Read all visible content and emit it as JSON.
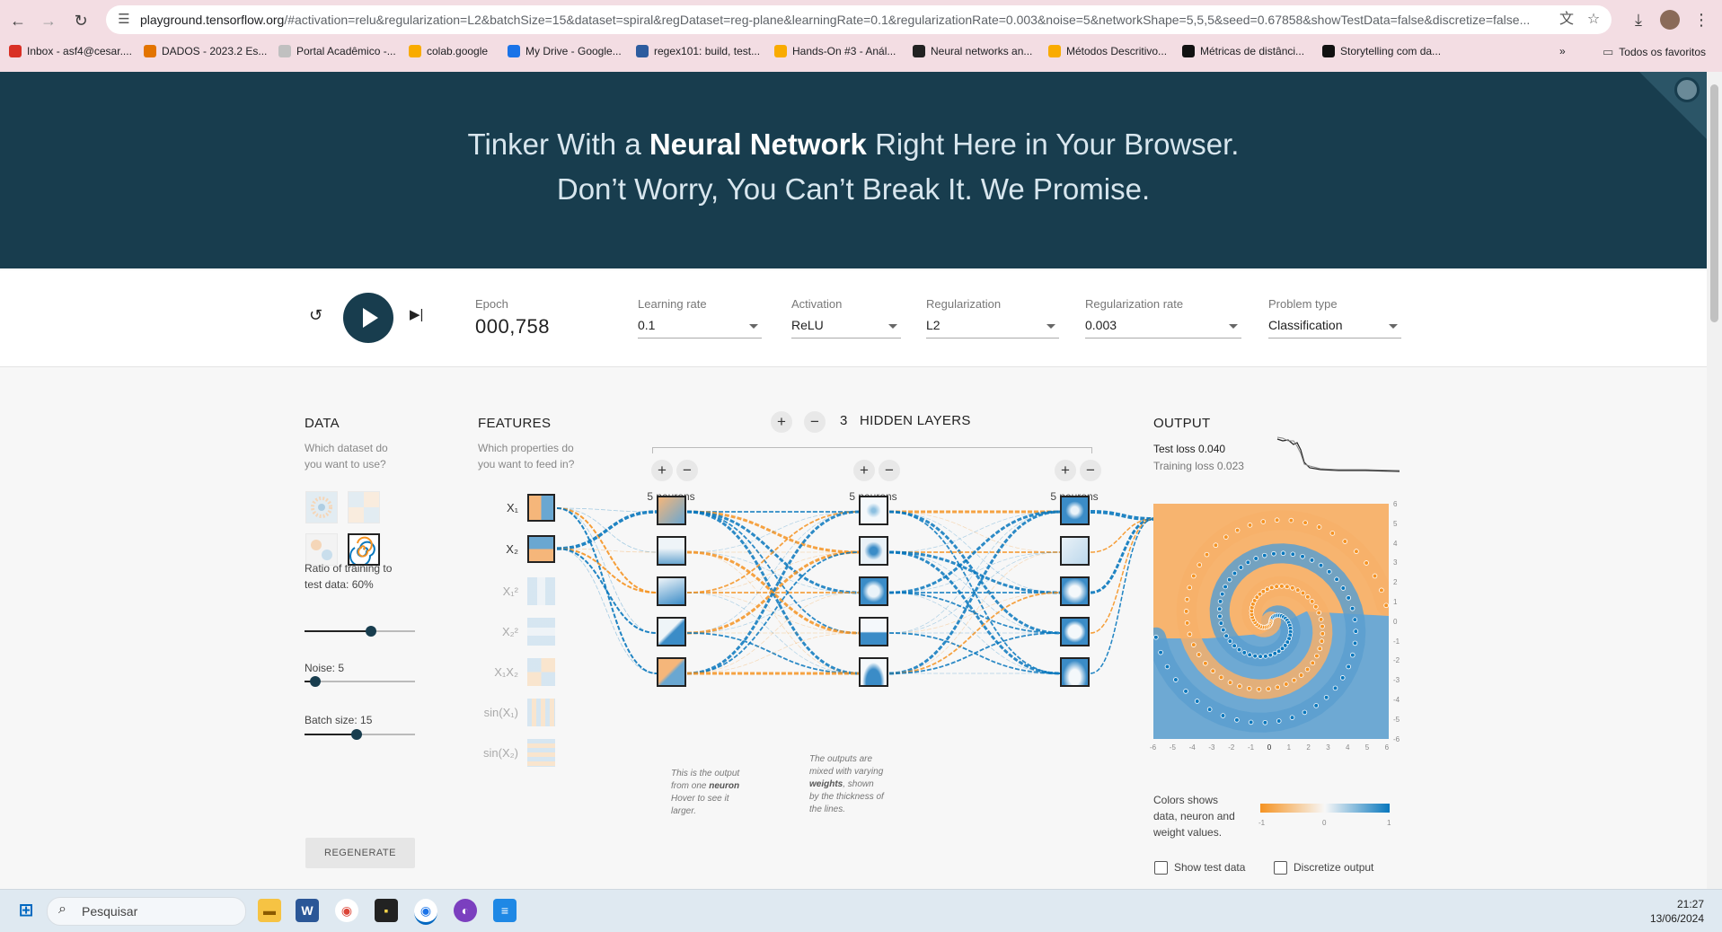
{
  "browser": {
    "url_host": "playground.tensorflow.org",
    "url_rest": "/#activation=relu&regularization=L2&batchSize=15&dataset=spiral&regDataset=reg-plane&learningRate=0.1&regularizationRate=0.003&noise=5&networkShape=5,5,5&seed=0.67858&showTestData=false&discretize=false...",
    "bookmarks": [
      {
        "label": "Inbox - asf4@cesar....",
        "icon": "gmail-icon",
        "color": "#d93025"
      },
      {
        "label": "DADOS - 2023.2 Es...",
        "icon": "folder-icon",
        "color": "#e37400"
      },
      {
        "label": "Portal Acadêmico -...",
        "icon": "portal-icon",
        "color": "#c0c0c0"
      },
      {
        "label": "colab.google",
        "icon": "colab-icon",
        "color": "#f9ab00"
      },
      {
        "label": "My Drive - Google...",
        "icon": "drive-icon",
        "color": "#1a73e8"
      },
      {
        "label": "regex101: build, test...",
        "icon": "regex-icon",
        "color": "#2d5c9f"
      },
      {
        "label": "Hands-On #3 - Anál...",
        "icon": "colab-icon",
        "color": "#f9ab00"
      },
      {
        "label": "Neural networks an...",
        "icon": "github-icon",
        "color": "#222222"
      },
      {
        "label": "Métodos Descritivo...",
        "icon": "colab-icon",
        "color": "#f9ab00"
      },
      {
        "label": "Métricas de distânci...",
        "icon": "medium-icon",
        "color": "#111111"
      },
      {
        "label": "Storytelling com da...",
        "icon": "amazon-icon",
        "color": "#111111"
      }
    ],
    "all_bookmarks": "Todos os favoritos"
  },
  "hero": {
    "line1_pre": "Tinker With a ",
    "line1_bold": "Neural Network",
    "line1_post": " Right Here in Your Browser.",
    "line2": "Don’t Worry, You Can’t Break It. We Promise."
  },
  "controls": {
    "epoch_label": "Epoch",
    "epoch_value": "000,758",
    "learning_rate_label": "Learning rate",
    "learning_rate": "0.1",
    "activation_label": "Activation",
    "activation": "ReLU",
    "regularization_label": "Regularization",
    "regularization": "L2",
    "regularization_rate_label": "Regularization rate",
    "regularization_rate": "0.003",
    "problem_type_label": "Problem type",
    "problem_type": "Classification"
  },
  "data_section": {
    "title": "DATA",
    "subtitle_line1": "Which dataset do",
    "subtitle_line2": "you want to use?",
    "ratio_label_line1": "Ratio of training to",
    "ratio_label_line2": "test data:  60%",
    "ratio_value": 0.6,
    "noise_label": "Noise:  5",
    "noise_value": 0.1,
    "batch_label": "Batch size:  15",
    "batch_value": 0.47,
    "regenerate": "REGENERATE",
    "selected_dataset": "spiral"
  },
  "features_section": {
    "title": "FEATURES",
    "subtitle_line1": "Which properties do",
    "subtitle_line2": "you want to feed in?",
    "features": [
      {
        "label": "X₁",
        "active": true
      },
      {
        "label": "X₂",
        "active": true
      },
      {
        "label": "X₁²",
        "active": false
      },
      {
        "label": "X₂²",
        "active": false
      },
      {
        "label": "X₁X₂",
        "active": false
      },
      {
        "label": "sin(X₁)",
        "active": false
      },
      {
        "label": "sin(X₂)",
        "active": false
      }
    ]
  },
  "network": {
    "hidden_count": "3",
    "hidden_label": "HIDDEN LAYERS",
    "layers": [
      {
        "neurons_label": "5 neurons"
      },
      {
        "neurons_label": "5 neurons"
      },
      {
        "neurons_label": "5 neurons"
      }
    ],
    "note1_a": "This is the output",
    "note1_b": "from one ",
    "note1_bold": "neuron",
    "note1_c": "Hover to see it",
    "note1_d": "larger.",
    "note2_a": "The outputs are",
    "note2_b": "mixed with varying",
    "note2_bold": "weights",
    "note2_c": ", shown",
    "note2_d": "by the thickness of",
    "note2_e": "the lines."
  },
  "output_section": {
    "title": "OUTPUT",
    "test_loss": "Test loss 0.040",
    "training_loss": "Training loss 0.023",
    "y_ticks": [
      "6",
      "5",
      "4",
      "3",
      "2",
      "1",
      "0",
      "-1",
      "-2",
      "-3",
      "-4",
      "-5",
      "-6"
    ],
    "x_ticks": [
      "-6",
      "-5",
      "-4",
      "-3",
      "-2",
      "-1",
      "0",
      "1",
      "2",
      "3",
      "4",
      "5",
      "6"
    ],
    "legend_line1": "Colors shows",
    "legend_line2": "data, neuron and",
    "legend_line3": "weight values.",
    "legend_min": "-1",
    "legend_mid": "0",
    "legend_max": "1",
    "show_test_data": "Show test data",
    "discretize_output": "Discretize output",
    "colors": {
      "orange": "#f59322",
      "blue": "#0877bd"
    }
  },
  "taskbar": {
    "search_placeholder": "Pesquisar",
    "time": "21:27",
    "date": "13/06/2024"
  }
}
